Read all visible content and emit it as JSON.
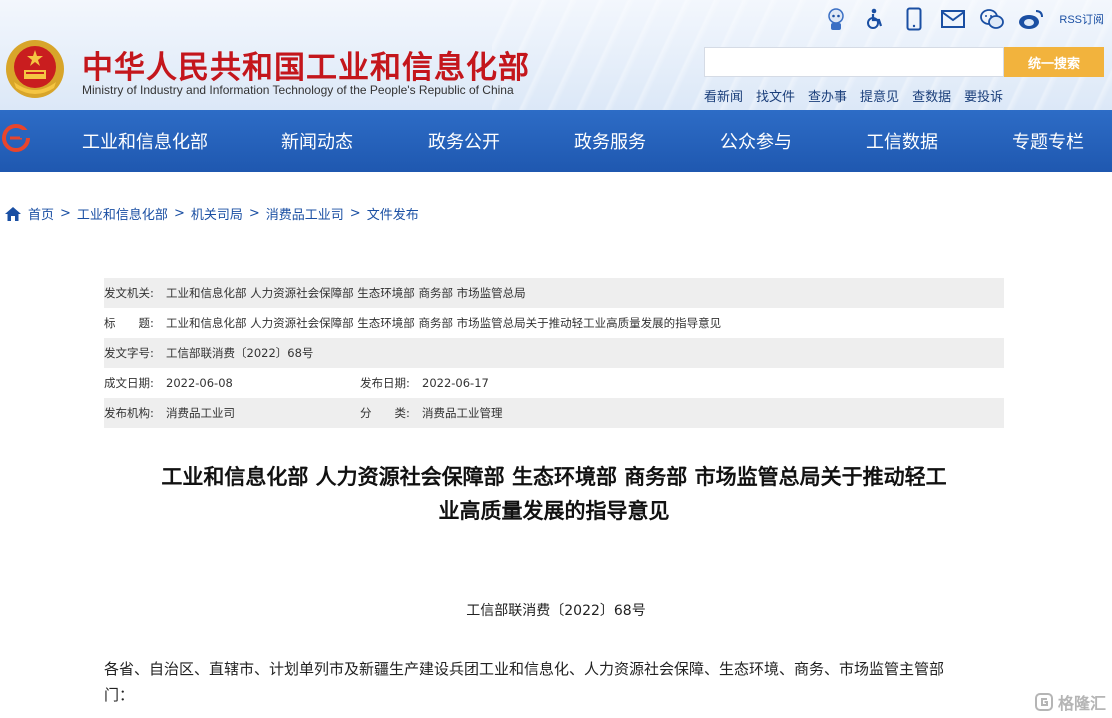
{
  "header": {
    "site_title": "中华人民共和国工业和信息化部",
    "site_subtitle": "Ministry of Industry and Information Technology of the People's Republic of China",
    "top_icons": [
      "robot-assistant-icon",
      "accessibility-icon",
      "mobile-icon",
      "mail-icon",
      "wechat-icon",
      "weibo-icon"
    ],
    "rss_label": "RSS订阅",
    "search": {
      "placeholder": "",
      "button_label": "统一搜索"
    },
    "quick_links": [
      "看新闻",
      "找文件",
      "查办事",
      "提意见",
      "查数据",
      "要投诉"
    ]
  },
  "nav": {
    "items": [
      "工业和信息化部",
      "新闻动态",
      "政务公开",
      "政务服务",
      "公众参与",
      "工信数据",
      "专题专栏"
    ]
  },
  "breadcrumb": [
    "首页",
    "工业和信息化部",
    "机关司局",
    "消费品工业司",
    "文件发布"
  ],
  "meta": {
    "issuer_key": "发文机关:",
    "issuer_value": "工业和信息化部 人力资源社会保障部 生态环境部 商务部 市场监管总局",
    "title_key": "标　　题:",
    "title_value": "工业和信息化部 人力资源社会保障部 生态环境部 商务部 市场监管总局关于推动轻工业高质量发展的指导意见",
    "docno_key": "发文字号:",
    "docno_value": "工信部联消费〔2022〕68号",
    "written_key": "成文日期:",
    "written_value": "2022-06-08",
    "published_key": "发布日期:",
    "published_value": "2022-06-17",
    "org_key": "发布机构:",
    "org_value": "消费品工业司",
    "category_key": "分　　类:",
    "category_value": "消费品工业管理"
  },
  "document": {
    "title_line1": "工业和信息化部 人力资源社会保障部 生态环境部 商务部 市场监管总局关于推动轻工",
    "title_line2": "业高质量发展的指导意见",
    "number": "工信部联消费〔2022〕68号",
    "salutation_line1": "各省、自治区、直辖市、计划单列市及新疆生产建设兵团工业和信息化、人力资源社会保障、生态环境、商务、市场监管主管部",
    "salutation_line2": "门："
  },
  "watermark": {
    "text": "格隆汇"
  },
  "colors": {
    "title_red": "#c4161c",
    "nav_blue": "#1f58b0",
    "search_orange": "#f2b33d",
    "link_blue": "#1a4fa3"
  }
}
